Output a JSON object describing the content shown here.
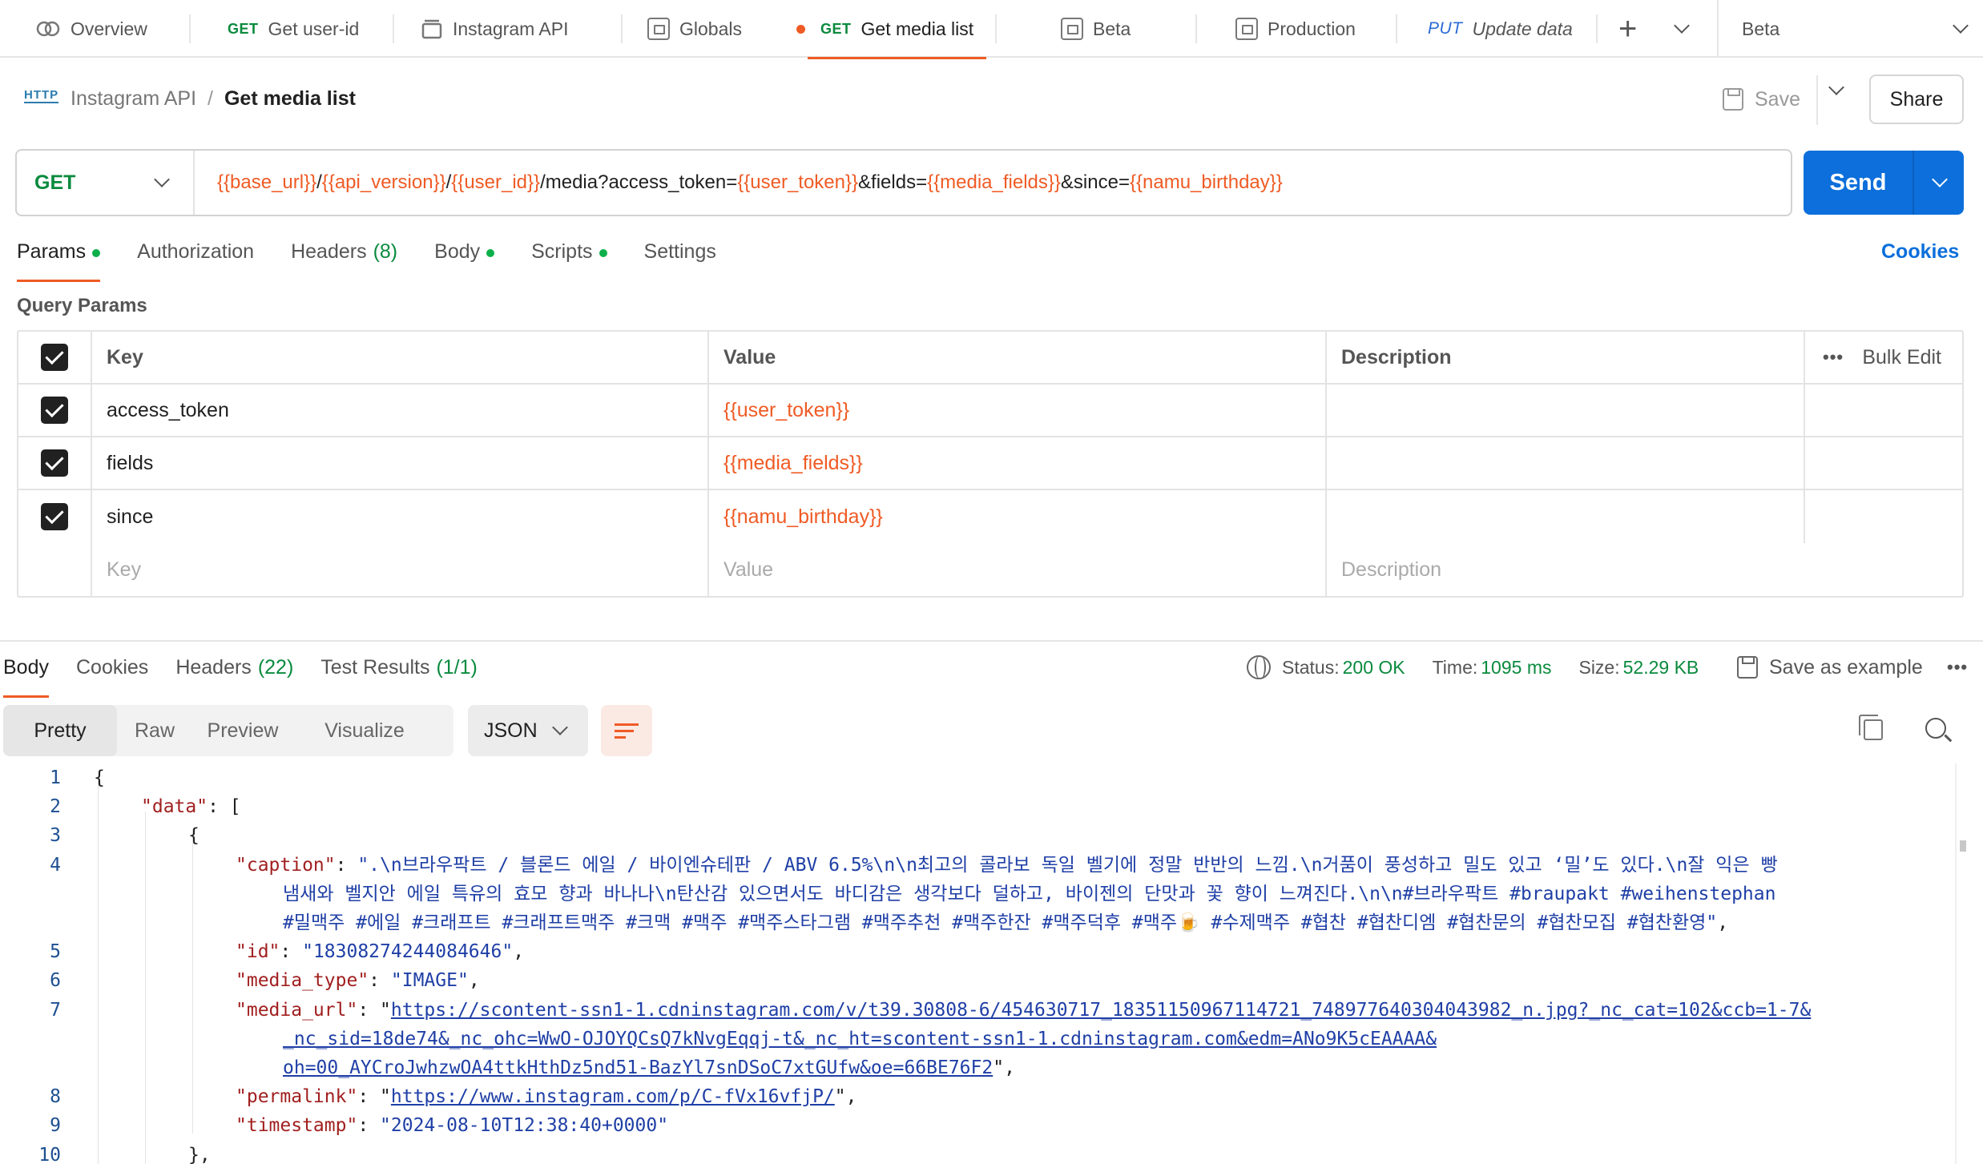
{
  "tabs": [
    {
      "method": "",
      "label": "Overview",
      "icon": "overview-icon"
    },
    {
      "method": "GET",
      "label": "Get user-id",
      "icon": ""
    },
    {
      "method": "",
      "label": "Instagram API",
      "icon": "collection-icon"
    },
    {
      "method": "",
      "label": "Globals",
      "icon": "environment-icon"
    },
    {
      "method": "GET",
      "label": "Get media list",
      "icon": ""
    },
    {
      "method": "",
      "label": "Beta",
      "icon": "environment-icon"
    },
    {
      "method": "",
      "label": "Production",
      "icon": "environment-icon"
    },
    {
      "method": "PUT",
      "label": "Update data",
      "icon": ""
    }
  ],
  "environment": {
    "selected": "Beta"
  },
  "breadcrumb": {
    "icon_text": "HTTP",
    "collection": "Instagram API",
    "separator": "/",
    "request": "Get media list"
  },
  "actions": {
    "save": "Save",
    "share": "Share"
  },
  "request": {
    "method": "GET",
    "url_parts": [
      {
        "t": "{{base_url}}",
        "var": true
      },
      {
        "t": "/",
        "var": false
      },
      {
        "t": "{{api_version}}",
        "var": true
      },
      {
        "t": "/",
        "var": false
      },
      {
        "t": "{{user_id}}",
        "var": true
      },
      {
        "t": "/media?access_token=",
        "var": false
      },
      {
        "t": "{{user_token}}",
        "var": true
      },
      {
        "t": "&fields=",
        "var": false
      },
      {
        "t": "{{media_fields}}",
        "var": true
      },
      {
        "t": "&since=",
        "var": false
      },
      {
        "t": "{{namu_birthday}}",
        "var": true
      }
    ],
    "send": "Send"
  },
  "request_tabs": [
    {
      "label": "Params",
      "count": "",
      "dot": true,
      "active": true
    },
    {
      "label": "Authorization",
      "count": "",
      "dot": false,
      "active": false
    },
    {
      "label": "Headers",
      "count": "(8)",
      "dot": false,
      "active": false
    },
    {
      "label": "Body",
      "count": "",
      "dot": true,
      "active": false
    },
    {
      "label": "Scripts",
      "count": "",
      "dot": true,
      "active": false
    },
    {
      "label": "Settings",
      "count": "",
      "dot": false,
      "active": false
    }
  ],
  "cookies_link": "Cookies",
  "query_params": {
    "title": "Query Params",
    "headers": {
      "key": "Key",
      "value": "Value",
      "description": "Description",
      "more": "•••",
      "bulk": "Bulk Edit"
    },
    "rows": [
      {
        "key": "access_token",
        "value": "{{user_token}}",
        "description": ""
      },
      {
        "key": "fields",
        "value": "{{media_fields}}",
        "description": ""
      },
      {
        "key": "since",
        "value": "{{namu_birthday}}",
        "description": ""
      }
    ],
    "placeholder": {
      "key": "Key",
      "value": "Value",
      "description": "Description"
    }
  },
  "response": {
    "tabs": [
      {
        "label": "Body",
        "count": "",
        "active": true
      },
      {
        "label": "Cookies",
        "count": "",
        "active": false
      },
      {
        "label": "Headers",
        "count": "(22)",
        "active": false
      },
      {
        "label": "Test Results",
        "count": "(1/1)",
        "active": false
      }
    ],
    "status_label": "Status:",
    "status_value": "200 OK",
    "time_label": "Time:",
    "time_value": "1095 ms",
    "size_label": "Size:",
    "size_value": "52.29 KB",
    "save_example": "Save as example",
    "more": "•••",
    "views": [
      "Pretty",
      "Raw",
      "Preview",
      "Visualize"
    ],
    "active_view": "Pretty",
    "format": "JSON"
  },
  "code_lines": [
    {
      "n": "1",
      "ind": 0,
      "tokens": [
        {
          "t": "{",
          "c": "p"
        }
      ]
    },
    {
      "n": "2",
      "ind": 1,
      "tokens": [
        {
          "t": "\"data\"",
          "c": "k"
        },
        {
          "t": ": [",
          "c": "p"
        }
      ]
    },
    {
      "n": "3",
      "ind": 2,
      "tokens": [
        {
          "t": "{",
          "c": "p"
        }
      ]
    },
    {
      "n": "4",
      "ind": 3,
      "tokens": [
        {
          "t": "\"caption\"",
          "c": "k"
        },
        {
          "t": ": ",
          "c": "p"
        },
        {
          "t": "\".\\n브라우팍트 / 블론드 에일 / 바이엔슈테판 / ABV 6.5%\\n\\n최고의 콜라보 독일 벨기에 정말 반반의 느낌.\\n거품이 풍성하고 밀도 있고 ‘밀’도 있다.\\n잘 익은 빵",
          "c": "s"
        }
      ]
    },
    {
      "n": "",
      "ind": 4,
      "tokens": [
        {
          "t": "냄새와 벨지안 에일 특유의 효모 향과 바나나\\n탄산감 있으면서도 바디감은 생각보다 덜하고, 바이젠의 단맛과 꽃 향이 느껴진다.\\n\\n#브라우팍트 #braupakt #weihenstephan",
          "c": "s"
        }
      ]
    },
    {
      "n": "",
      "ind": 4,
      "tokens": [
        {
          "t": "#밀맥주 #에일 #크래프트 #크래프트맥주 #크맥 #맥주 #맥주스타그램 #맥주추천 #맥주한잔 #맥주덕후 #맥주🍺 #수제맥주 #협찬 #협찬디엠 #협찬문의 #협찬모집 #협찬환영\"",
          "c": "s"
        },
        {
          "t": ",",
          "c": "p"
        }
      ]
    },
    {
      "n": "5",
      "ind": 3,
      "tokens": [
        {
          "t": "\"id\"",
          "c": "k"
        },
        {
          "t": ": ",
          "c": "p"
        },
        {
          "t": "\"18308274244084646\"",
          "c": "s"
        },
        {
          "t": ",",
          "c": "p"
        }
      ]
    },
    {
      "n": "6",
      "ind": 3,
      "tokens": [
        {
          "t": "\"media_type\"",
          "c": "k"
        },
        {
          "t": ": ",
          "c": "p"
        },
        {
          "t": "\"IMAGE\"",
          "c": "s"
        },
        {
          "t": ",",
          "c": "p"
        }
      ]
    },
    {
      "n": "7",
      "ind": 3,
      "tokens": [
        {
          "t": "\"media_url\"",
          "c": "k"
        },
        {
          "t": ": \"",
          "c": "p"
        },
        {
          "t": "https://scontent-ssn1-1.cdninstagram.com/v/t39.30808-6/454630717_18351150967114721_748977640304043982_n.jpg?_nc_cat=102&ccb=1-7&",
          "c": "u"
        }
      ]
    },
    {
      "n": "",
      "ind": 4,
      "tokens": [
        {
          "t": "_nc_sid=18de74&_nc_ohc=WwO-OJOYQCsQ7kNvgEqqj-t&_nc_ht=scontent-ssn1-1.cdninstagram.com&edm=ANo9K5cEAAAA&",
          "c": "u"
        }
      ]
    },
    {
      "n": "",
      "ind": 4,
      "tokens": [
        {
          "t": "oh=00_AYCroJwhzwOA4ttkHthDz5nd51-BazYl7snDSoC7xtGUfw&oe=66BE76F2",
          "c": "u"
        },
        {
          "t": "\",",
          "c": "p"
        }
      ]
    },
    {
      "n": "8",
      "ind": 3,
      "tokens": [
        {
          "t": "\"permalink\"",
          "c": "k"
        },
        {
          "t": ": \"",
          "c": "p"
        },
        {
          "t": "https://www.instagram.com/p/C-fVx16vfjP/",
          "c": "u"
        },
        {
          "t": "\",",
          "c": "p"
        }
      ]
    },
    {
      "n": "9",
      "ind": 3,
      "tokens": [
        {
          "t": "\"timestamp\"",
          "c": "k"
        },
        {
          "t": ": ",
          "c": "p"
        },
        {
          "t": "\"2024-08-10T12:38:40+0000\"",
          "c": "s"
        }
      ]
    },
    {
      "n": "10",
      "ind": 2,
      "tokens": [
        {
          "t": "},",
          "c": "p"
        }
      ]
    }
  ],
  "colors": {
    "accent": "#ef5b25",
    "send": "#0c6fdb",
    "success": "#0a8a3e",
    "variable": "#ef5b25"
  }
}
